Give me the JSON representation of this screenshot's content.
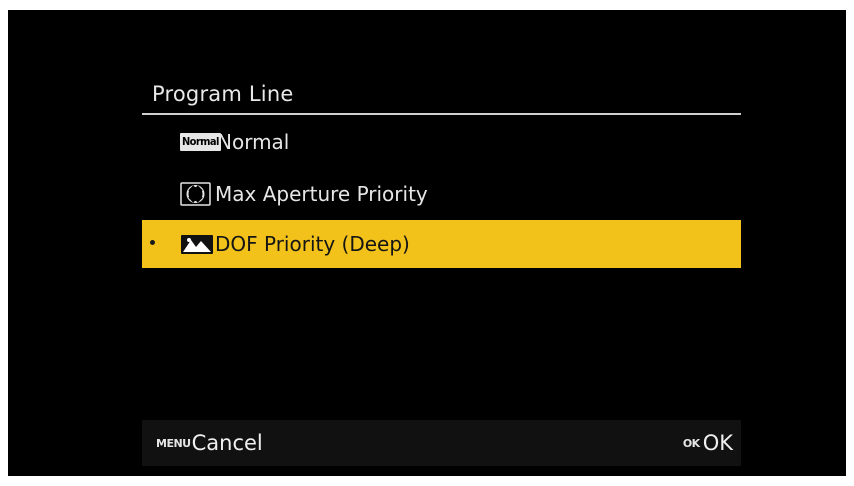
{
  "screen": {
    "title": "Program Line",
    "items": [
      {
        "icon": "normal-badge-icon",
        "badge": "Normal",
        "label": "Normal",
        "selected": false
      },
      {
        "icon": "aperture-ring-icon",
        "label": "Max Aperture Priority",
        "selected": false
      },
      {
        "icon": "mountain-landscape-icon",
        "label": "DOF Priority (Deep)",
        "selected": true
      }
    ],
    "selected_color": "#f2c21a",
    "footer": {
      "cancel_key": "MENU",
      "cancel_label": "Cancel",
      "ok_key": "OK",
      "ok_label": "OK"
    }
  }
}
